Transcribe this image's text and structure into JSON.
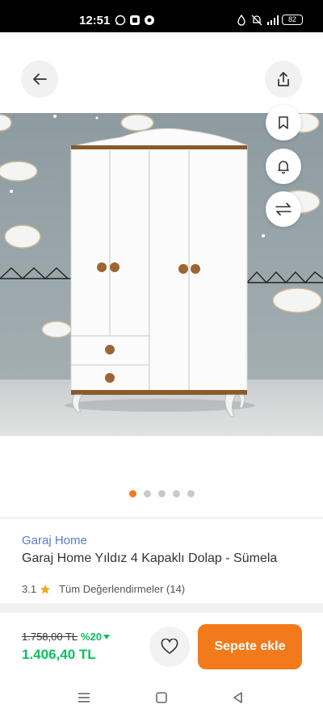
{
  "status_bar": {
    "time": "12:51",
    "battery": "82",
    "left_icons": [
      "whatsapp-icon",
      "message-app-icon",
      "chrome-icon"
    ],
    "right_icons": [
      "data-saver-icon",
      "mute-icon",
      "signal-4g-icon"
    ]
  },
  "top_bar": {
    "back_icon": "arrow-left-icon",
    "share_icon": "share-icon"
  },
  "side_actions": [
    "bookmark-icon",
    "bell-icon",
    "compare-arrows-icon"
  ],
  "gallery": {
    "image_label": "Product photo: white 4-door wardrobe with wooden knobs in a child's room",
    "dots": 5,
    "active_dot": 0
  },
  "product": {
    "brand": "Garaj Home",
    "title": "Garaj Home Yıldız 4 Kapaklı Dolap - Sümela",
    "rating": "3.1",
    "reviews_label": "Tüm Değerlendirmeler (14)"
  },
  "purchase": {
    "old_price": "1.758,00 TL",
    "discount": "%20",
    "new_price": "1.406,40 TL",
    "add_to_cart": "Sepete ekle"
  },
  "colors": {
    "accent": "#f27a1a",
    "discount_green": "#0bc15c",
    "brand_blue": "#5b7bd5",
    "wall": "#8e9da2"
  },
  "nav_bar": [
    "menu-icon",
    "home-square-icon",
    "back-triangle-icon"
  ]
}
